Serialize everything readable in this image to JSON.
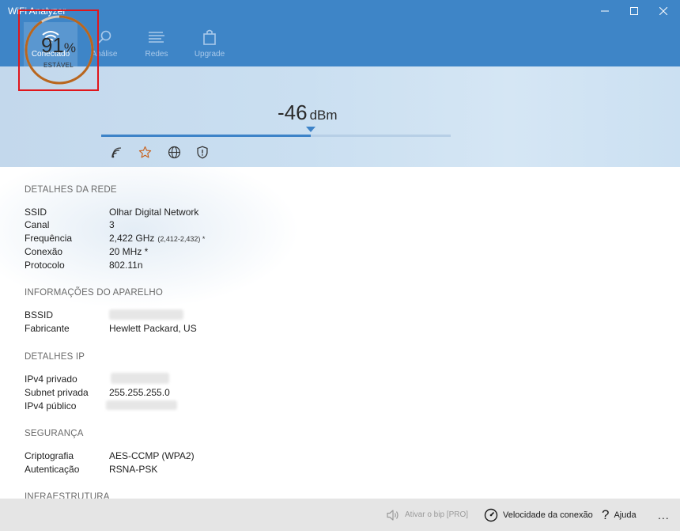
{
  "window": {
    "title": "WiFi Analyzer"
  },
  "tabs": [
    {
      "label": "Conectado",
      "icon": "wifi-icon"
    },
    {
      "label": "Análise",
      "icon": "search-icon"
    },
    {
      "label": "Redes",
      "icon": "list-icon"
    },
    {
      "label": "Upgrade",
      "icon": "shopping-bag-icon"
    }
  ],
  "status": {
    "quality_value": "91",
    "quality_unit": "%",
    "quality_fraction": 0.91,
    "quality_label": "ESTÁVEL",
    "signal_value": "-46",
    "signal_unit": "dBm",
    "signal_fraction": 0.6,
    "header_icons": [
      "wifi-signal-icon",
      "star-icon",
      "globe-icon",
      "shield-icon"
    ]
  },
  "colors": {
    "titlebar": "#3e85c7",
    "tab_active": "#5a97d0",
    "gauge_ring": "#b8661f",
    "gauge_track": "#d8c9bb",
    "highlight_box": "#e0161b",
    "signal_bar": "#3d83c8"
  },
  "details": {
    "network_title": "DETALHES DA REDE",
    "ssid_label": "SSID",
    "ssid_value": "Olhar Digital Network",
    "channel_label": "Canal",
    "channel_value": "3",
    "frequency_label": "Frequência",
    "frequency_value": "2,422 GHz",
    "frequency_range": "(2,412-2,432) *",
    "connection_label": "Conexão",
    "connection_value": "20 MHz *",
    "protocol_label": "Protocolo",
    "protocol_value": "802.11n",
    "device_title": "INFORMAÇÕES DO APARELHO",
    "bssid_label": "BSSID",
    "manufacturer_label": "Fabricante",
    "manufacturer_value": "Hewlett Packard, US",
    "ip_title": "DETALHES IP",
    "private_ipv4_label": "IPv4 privado",
    "subnet_label": "Subnet privada",
    "subnet_value": "255.255.255.0",
    "public_ipv4_label": "IPv4 público",
    "security_title": "SEGURANÇA",
    "encryption_label": "Criptografia",
    "encryption_value": "AES-CCMP (WPA2)",
    "auth_label": "Autenticação",
    "auth_value": "RSNA-PSK",
    "infra_title": "INFRAESTRUTURA"
  },
  "bottom": {
    "beep_label": "Ativar o bip [PRO]",
    "speed_label": "Velocidade da conexão",
    "help_label": "Ajuda",
    "more_label": "..."
  }
}
